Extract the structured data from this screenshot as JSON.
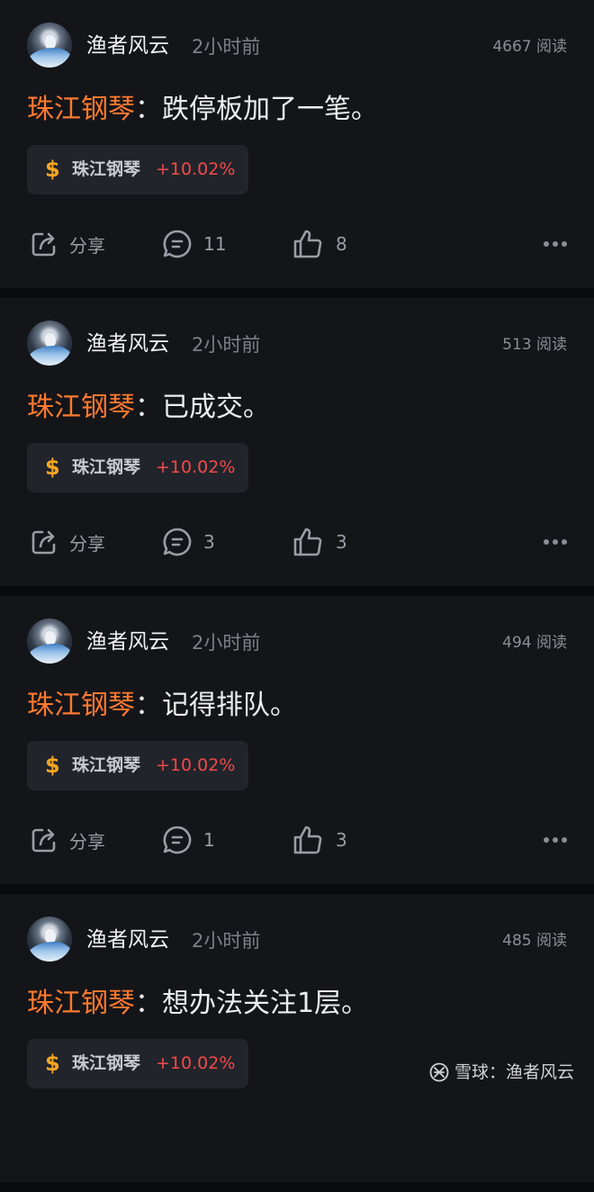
{
  "posts": [
    {
      "username": "渔者风云",
      "time": "2小时前",
      "reads": "4667 阅读",
      "stock_mention": "珠江钢琴",
      "colon": "：",
      "text": "跌停板加了一笔。",
      "chip": {
        "symbol": "$",
        "name": "珠江钢琴",
        "change": "+10.02%"
      },
      "share_label": "分享",
      "comments": "11",
      "likes": "8"
    },
    {
      "username": "渔者风云",
      "time": "2小时前",
      "reads": "513 阅读",
      "stock_mention": "珠江钢琴",
      "colon": "：",
      "text": "已成交。",
      "chip": {
        "symbol": "$",
        "name": "珠江钢琴",
        "change": "+10.02%"
      },
      "share_label": "分享",
      "comments": "3",
      "likes": "3"
    },
    {
      "username": "渔者风云",
      "time": "2小时前",
      "reads": "494 阅读",
      "stock_mention": "珠江钢琴",
      "colon": "：",
      "text": "记得排队。",
      "chip": {
        "symbol": "$",
        "name": "珠江钢琴",
        "change": "+10.02%"
      },
      "share_label": "分享",
      "comments": "1",
      "likes": "3"
    },
    {
      "username": "渔者风云",
      "time": "2小时前",
      "reads": "485 阅读",
      "stock_mention": "珠江钢琴",
      "colon": "：",
      "text": "想办法关注1层。",
      "chip": {
        "symbol": "$",
        "name": "珠江钢琴",
        "change": "+10.02%"
      }
    }
  ],
  "watermark": "雪球：渔者风云",
  "colors": {
    "background": "#0a0b0f",
    "card": "#141519",
    "stock_mention": "#ff7a2f",
    "price_up": "#f04a4a",
    "dollar": "#f5a623"
  },
  "icons": [
    "avatar-image",
    "share-icon",
    "comment-icon",
    "like-icon",
    "more-icon",
    "snowball-logo-icon"
  ]
}
